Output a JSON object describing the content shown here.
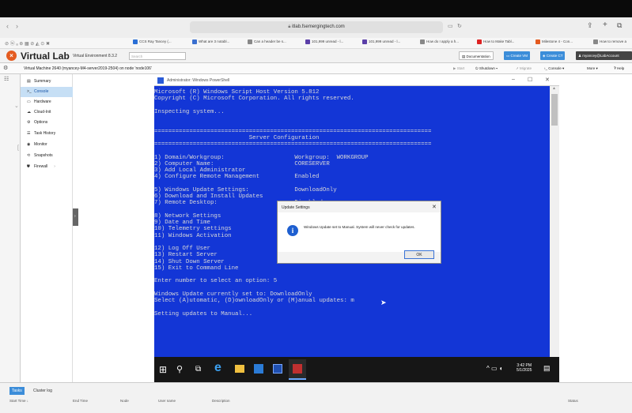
{
  "browser": {
    "url": "itlab.fsemergingtech.com",
    "bookmarks": [
      "CCS Ray Tancey (...",
      "What are 3 notabl...",
      "Can a header be s...",
      "101,999 unread - l...",
      "101,999 unread - l...",
      "How do I apply a h...",
      "How to Make Tabl...",
      "Milestone 4 - Con...",
      "How to remove a"
    ]
  },
  "app": {
    "logo_letter": "×",
    "title": "Virtual Lab",
    "subtitle": "Virtual Environment 8.3.2",
    "search_placeholder": "Search",
    "documentation": "Documentation",
    "create_vm": "Create VM",
    "create_ct": "Create CT",
    "user": "myancey@LabAccount",
    "help": "Help"
  },
  "vm": {
    "title": "Virtual Machine 2640 (myancey-M4-server2019-2504) on node 'node106'",
    "start": "Start",
    "shutdown": "Shutdown",
    "migrate": "Migrate",
    "console": "Console",
    "more": "More",
    "help": "Help"
  },
  "nav": [
    {
      "icon": "▤",
      "label": "Summary"
    },
    {
      "icon": ">_",
      "label": "Console"
    },
    {
      "icon": "▭",
      "label": "Hardware"
    },
    {
      "icon": "☁",
      "label": "Cloud-Init"
    },
    {
      "icon": "⚙",
      "label": "Options"
    },
    {
      "icon": "☰",
      "label": "Task History"
    },
    {
      "icon": "◉",
      "label": "Monitor"
    },
    {
      "icon": "⟲",
      "label": "Snapshots"
    },
    {
      "icon": "⛊",
      "label": "Firewall"
    }
  ],
  "powershell": {
    "title": "Administrator: Windows PowerShell",
    "lines": [
      "Microsoft (R) Windows Script Host Version 5.812",
      "Copyright (C) Microsoft Corporation. All rights reserved.",
      "",
      "Inspecting system...",
      "",
      "",
      "===============================================================================",
      "                           Server Configuration",
      "===============================================================================",
      "",
      "1) Domain/Workgroup:                    Workgroup:  WORKGROUP",
      "2) Computer Name:                       CORESERVER",
      "3) Add Local Administrator",
      "4) Configure Remote Management          Enabled",
      "",
      "5) Windows Update Settings:             DownloadOnly",
      "6) Download and Install Updates",
      "7) Remote Desktop:                      Disabled",
      "",
      "8) Network Settings",
      "9) Date and Time",
      "10) Telemetry settings",
      "11) Windows Activation",
      "",
      "12) Log Off User",
      "13) Restart Server",
      "14) Shut Down Server",
      "15) Exit to Command Line",
      "",
      "Enter number to select an option: 5",
      "",
      "Windows Update currently set to: DownloadOnly",
      "Select (A)utomatic, (D)ownloadOnly or (M)anual updates: m",
      "",
      "Setting updates to Manual..."
    ]
  },
  "dialog": {
    "title": "Update Settings",
    "message": "Windows Update set to Manual. System will never check for updates.",
    "ok": "OK"
  },
  "taskbar": {
    "time": "3:42 PM",
    "date": "5/1/2025"
  },
  "bottom": {
    "tabs": [
      "Tasks",
      "Cluster log"
    ],
    "columns": [
      "Start Time ↓",
      "End Time",
      "Node",
      "User name",
      "Description",
      "Status"
    ]
  }
}
